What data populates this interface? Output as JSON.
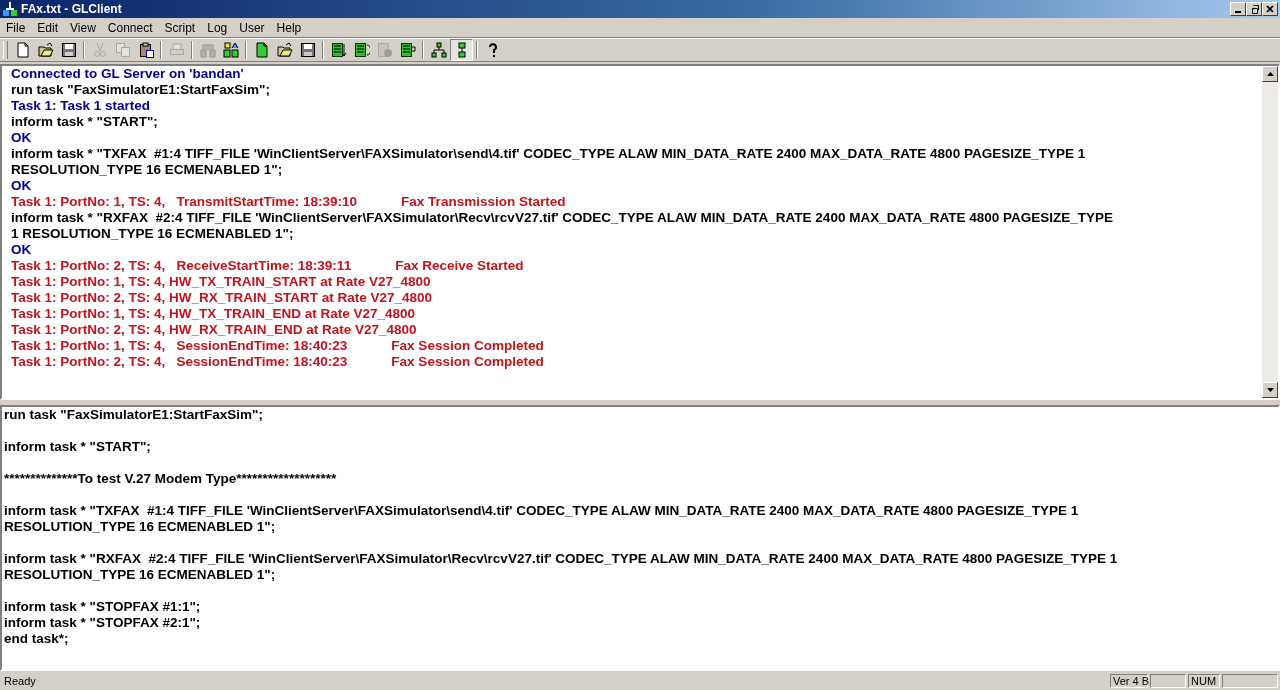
{
  "window": {
    "title": "FAx.txt - GLClient"
  },
  "menu": [
    "File",
    "Edit",
    "View",
    "Connect",
    "Script",
    "Log",
    "User",
    "Help"
  ],
  "toolbar": [
    [
      {
        "kind": "new",
        "disabled": false,
        "pressed": false
      },
      {
        "kind": "open",
        "disabled": false,
        "pressed": false
      },
      {
        "kind": "save",
        "disabled": false,
        "pressed": false
      }
    ],
    [
      {
        "kind": "cut",
        "disabled": true,
        "pressed": false
      },
      {
        "kind": "copy",
        "disabled": true,
        "pressed": false
      },
      {
        "kind": "paste",
        "disabled": false,
        "pressed": false
      }
    ],
    [
      {
        "kind": "print",
        "disabled": true,
        "pressed": false
      }
    ],
    [
      {
        "kind": "disconnect",
        "disabled": true,
        "pressed": false
      },
      {
        "kind": "connect",
        "disabled": false,
        "pressed": false
      }
    ],
    [
      {
        "kind": "script-new",
        "disabled": false,
        "pressed": false
      },
      {
        "kind": "open",
        "disabled": false,
        "pressed": false
      },
      {
        "kind": "save",
        "disabled": false,
        "pressed": false
      }
    ],
    [
      {
        "kind": "sheet-down",
        "disabled": false,
        "pressed": false
      },
      {
        "kind": "sheet-cycle",
        "disabled": false,
        "pressed": false
      },
      {
        "kind": "sheet-record",
        "disabled": true,
        "pressed": false
      },
      {
        "kind": "sheet-return",
        "disabled": false,
        "pressed": false
      }
    ],
    [
      {
        "kind": "tree",
        "disabled": false,
        "pressed": false
      },
      {
        "kind": "split",
        "disabled": false,
        "pressed": true
      }
    ],
    [
      {
        "kind": "help",
        "disabled": false,
        "pressed": false
      }
    ]
  ],
  "log": [
    {
      "kind": "status",
      "text": "Connected to GL Server on 'bandan'"
    },
    {
      "kind": "command",
      "text": "run task \"FaxSimulatorE1:StartFaxSim\";"
    },
    {
      "kind": "status",
      "text": "Task 1: Task 1 started"
    },
    {
      "kind": "command",
      "text": "inform task * \"START\";"
    },
    {
      "kind": "status",
      "text": "OK"
    },
    {
      "kind": "command",
      "text": "inform task * \"TXFAX  #1:4 TIFF_FILE 'WinClientServer\\FAXSimulator\\send\\4.tif' CODEC_TYPE ALAW MIN_DATA_RATE 2400 MAX_DATA_RATE 4800 PAGESIZE_TYPE 1 RESOLUTION_TYPE 16 ECMENABLED 1\";"
    },
    {
      "kind": "status",
      "text": "OK"
    },
    {
      "kind": "event",
      "text": "Task 1: PortNo: 1, TS: 4,   TransmitStartTime: 18:39:10",
      "detail": "Fax Transmission Started"
    },
    {
      "kind": "command",
      "text": "inform task * \"RXFAX  #2:4 TIFF_FILE 'WinClientServer\\FAXSimulator\\Recv\\rcvV27.tif' CODEC_TYPE ALAW MIN_DATA_RATE 2400 MAX_DATA_RATE 4800 PAGESIZE_TYPE 1 RESOLUTION_TYPE 16 ECMENABLED 1\";"
    },
    {
      "kind": "status",
      "text": "OK"
    },
    {
      "kind": "event",
      "text": "Task 1: PortNo: 2, TS: 4,   ReceiveStartTime: 18:39:11",
      "detail": "Fax Receive Started"
    },
    {
      "kind": "event",
      "text": "Task 1: PortNo: 1, TS: 4, HW_TX_TRAIN_START at Rate V27_4800"
    },
    {
      "kind": "event",
      "text": "Task 1: PortNo: 2, TS: 4, HW_RX_TRAIN_START at Rate V27_4800"
    },
    {
      "kind": "event",
      "text": "Task 1: PortNo: 1, TS: 4, HW_TX_TRAIN_END at Rate V27_4800"
    },
    {
      "kind": "event",
      "text": "Task 1: PortNo: 2, TS: 4, HW_RX_TRAIN_END at Rate V27_4800"
    },
    {
      "kind": "event",
      "text": "Task 1: PortNo: 1, TS: 4,   SessionEndTime: 18:40:23",
      "detail": "Fax Session Completed"
    },
    {
      "kind": "event",
      "text": "Task 1: PortNo: 2, TS: 4,   SessionEndTime: 18:40:23",
      "detail": "Fax Session Completed"
    }
  ],
  "script": [
    [
      "run task \"FaxSimulatorE1:StartFaxSim\";"
    ],
    [
      "inform task * \"START\";"
    ],
    [
      "**************To test V.27 Modem Type*******************"
    ],
    [
      "inform task * \"TXFAX  #1:4 TIFF_FILE 'WinClientServer\\FAXSimulator\\send\\4.tif' CODEC_TYPE ALAW MIN_DATA_RATE 2400 MAX_DATA_RATE 4800 PAGESIZE_TYPE 1 RESOLUTION_TYPE 16 ECMENABLED 1\";"
    ],
    [
      "inform task * \"RXFAX  #2:4 TIFF_FILE 'WinClientServer\\FAXSimulator\\Recv\\rcvV27.tif' CODEC_TYPE ALAW MIN_DATA_RATE 2400 MAX_DATA_RATE 4800 PAGESIZE_TYPE 1 RESOLUTION_TYPE 16 ECMENABLED 1\";"
    ],
    [
      "inform task * \"STOPFAX #1:1\";",
      "inform task * \"STOPFAX #2:1\";",
      "end task*;"
    ]
  ],
  "status_bar": {
    "message": "Ready",
    "panes": [
      "Ver 4 B",
      "NUM"
    ]
  }
}
